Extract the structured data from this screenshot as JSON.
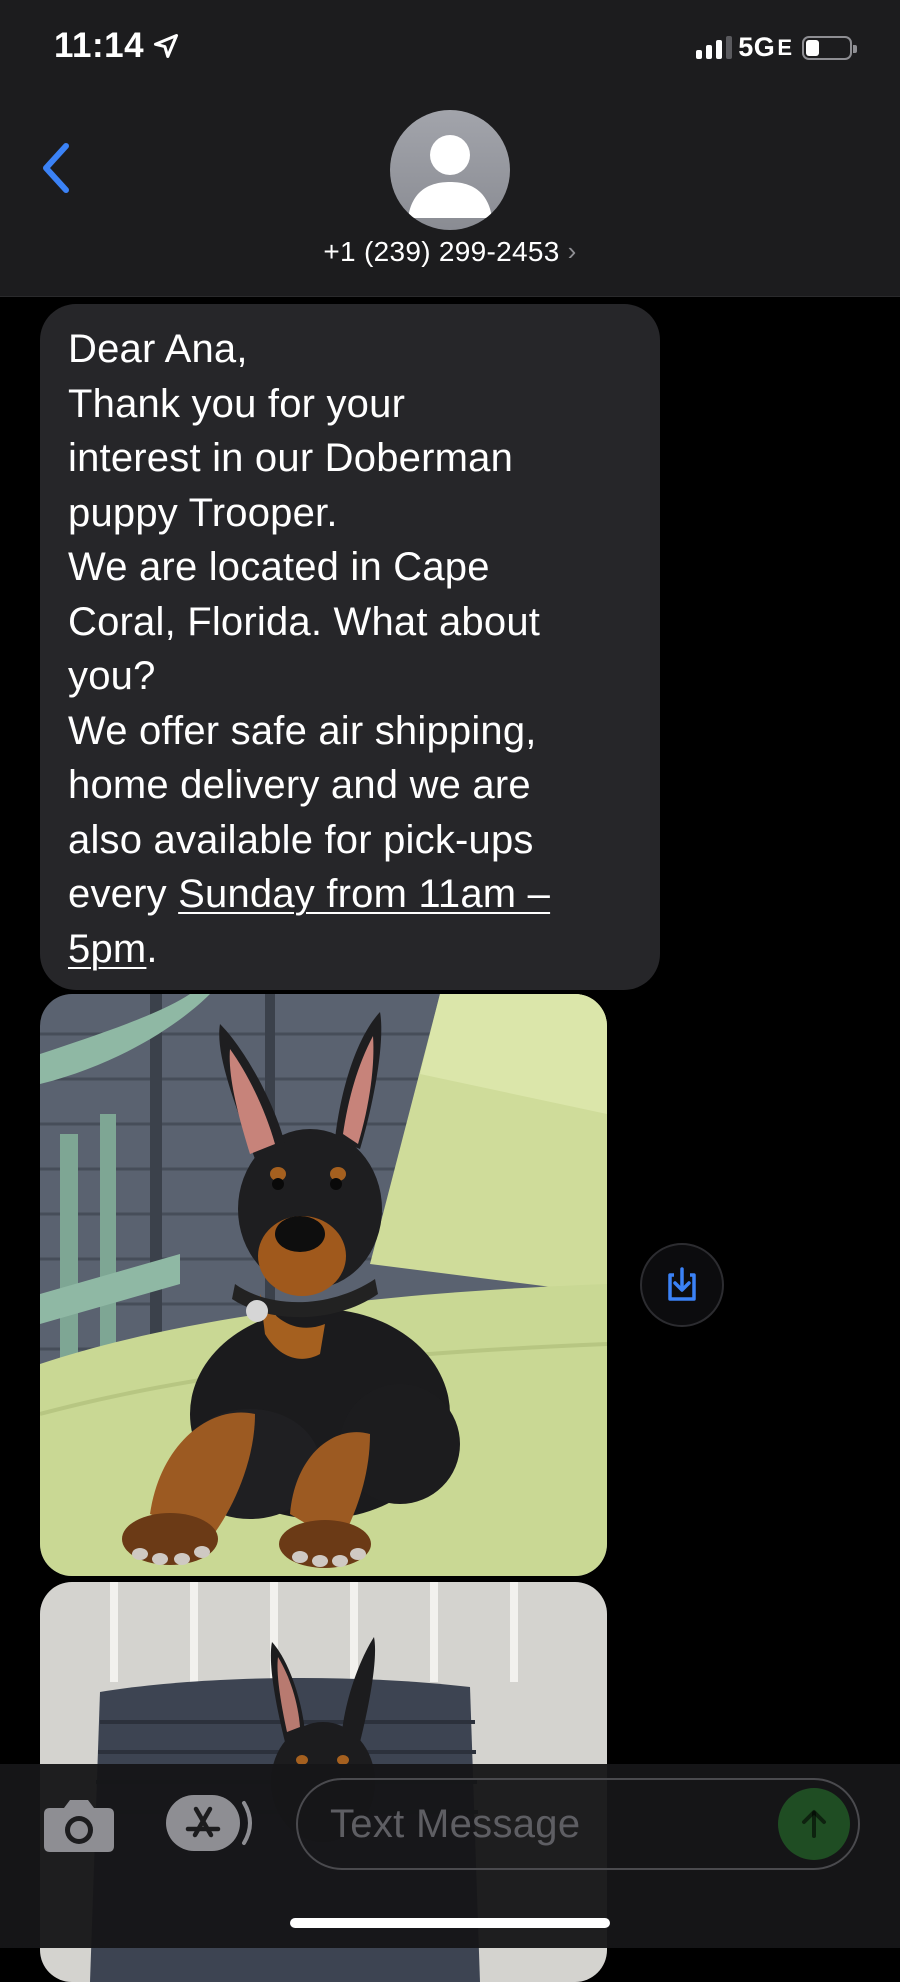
{
  "status_bar": {
    "time": "11:14",
    "network": "5G",
    "network_suffix": "E",
    "battery_percent": 30,
    "icons": [
      "location-arrow-icon",
      "signal-icon",
      "battery-icon"
    ]
  },
  "header": {
    "contact_phone": "+1 (239) 299-2453",
    "contact_chevron": "›",
    "back_icon": "chevron-left-icon",
    "avatar_icon": "person-silhouette-icon"
  },
  "messages": [
    {
      "type": "text",
      "text_before_link": "Dear Ana,\nThank you for your\ninterest in our Doberman\npuppy Trooper.\nWe are located in Cape\nCoral, Florida. What about\nyou?\nWe offer safe air shipping,\nhome delivery and we are\nalso available for pick-ups\nevery ",
      "link_text": "Sunday from 11am –\n5pm",
      "text_after_link": "."
    },
    {
      "type": "image",
      "subject": "doberman-puppy-on-lounge-chair"
    },
    {
      "type": "image",
      "subject": "doberman-puppy-on-wicker-chair"
    }
  ],
  "save_button_icon": "save-download-icon",
  "composer": {
    "placeholder": "Text Message",
    "camera_icon": "camera-icon",
    "appstore_icon": "app-store-icon",
    "send_icon": "send-arrow-icon"
  },
  "colors": {
    "accent_blue": "#3b82f6",
    "bubble_gray": "#262629",
    "header_bg": "#1c1c1e",
    "send_green_disabled": "#1f4d23"
  }
}
